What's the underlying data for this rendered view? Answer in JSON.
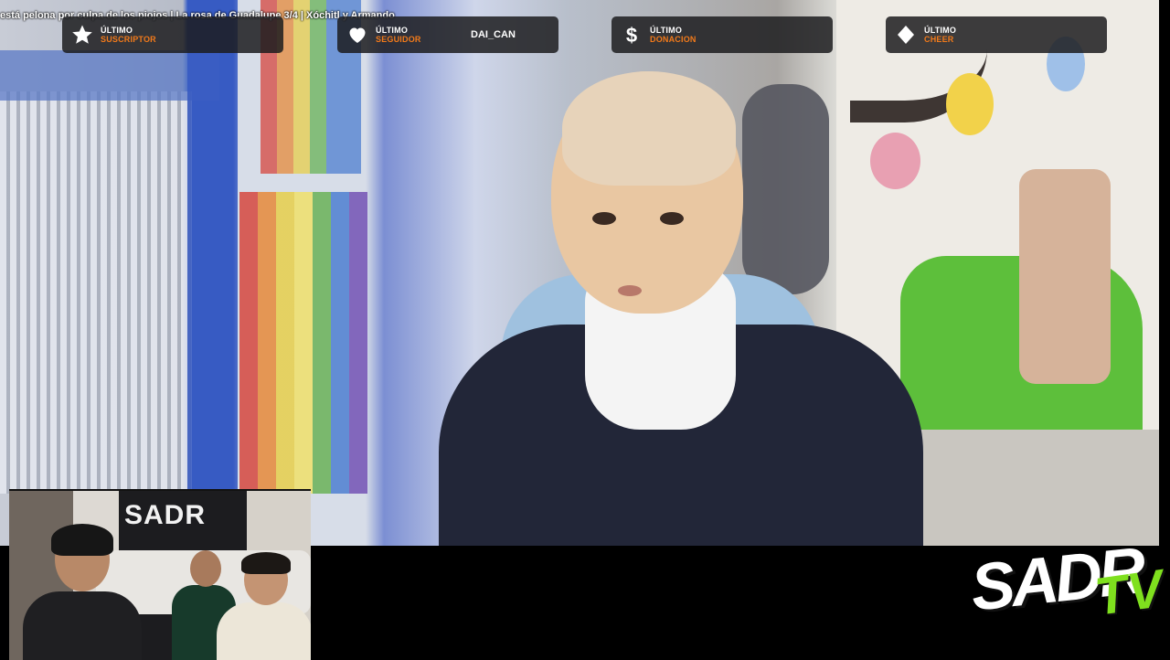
{
  "stream": {
    "ticker_text": "está pelona por culpa de los piojos | La rosa de Guadalupe 3/4 | Xóchitl y Armando",
    "accent_color": "#f27a1a"
  },
  "widgets": [
    {
      "icon": "star-icon",
      "line1": "ÚLTIMO",
      "line2": "SUSCRIPTOR",
      "value": ""
    },
    {
      "icon": "heart-icon",
      "line1": "ÚLTIMO",
      "line2": "SEGUIDOR",
      "value": "DAI_CAN"
    },
    {
      "icon": "dollar-icon",
      "line1": "ÚLTIMO",
      "line2": "DONACION",
      "value": ""
    },
    {
      "icon": "diamond-icon",
      "line1": "ÚLTIMO",
      "line2": "CHEER",
      "value": ""
    }
  ],
  "webcam": {
    "banner_text": "SADR"
  },
  "logo": {
    "main": "SADR",
    "suffix": "TV",
    "suffix_color": "#7fe01e"
  }
}
